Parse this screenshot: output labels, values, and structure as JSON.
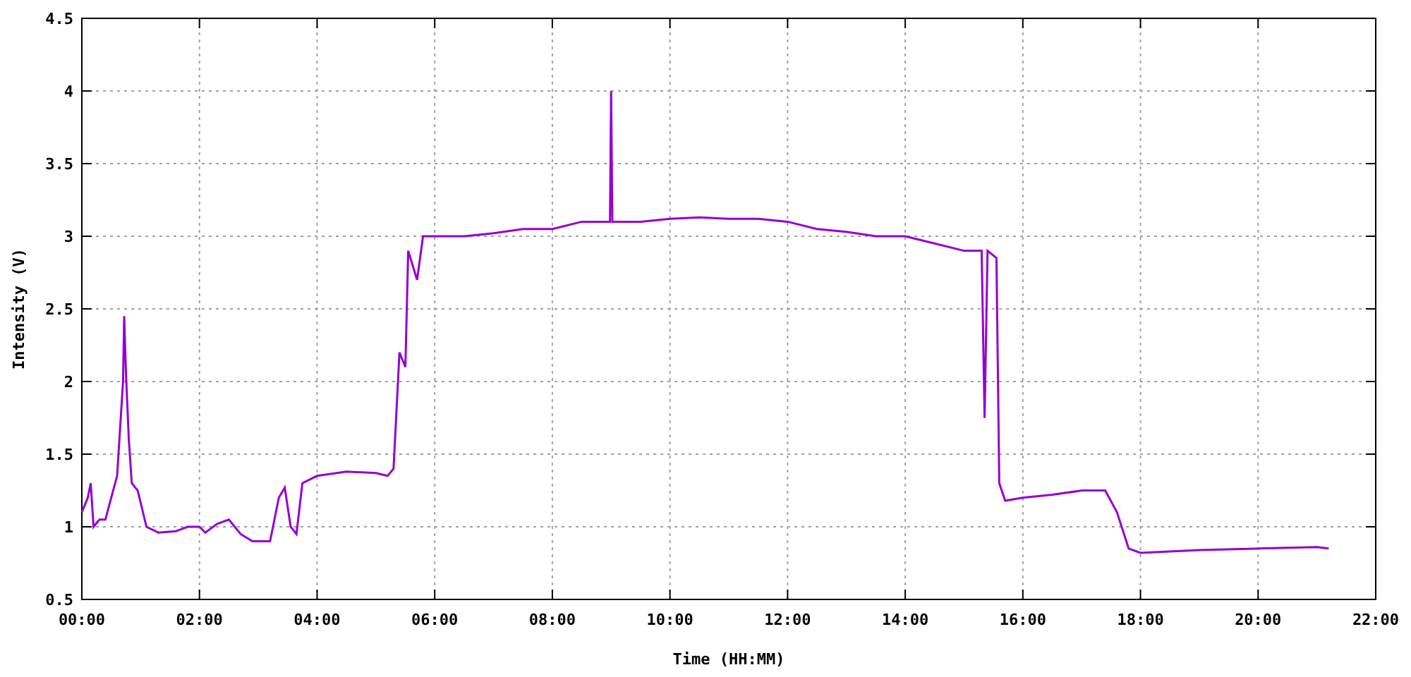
{
  "chart": {
    "chart_data": {
      "type": "line",
      "xlabel": "Time (HH:MM)",
      "ylabel": "Intensity (V)",
      "xlim": [
        0,
        22
      ],
      "ylim": [
        0.5,
        4.5
      ],
      "grid": true,
      "xticks": [
        {
          "value": 0,
          "label": "00:00"
        },
        {
          "value": 2,
          "label": "02:00"
        },
        {
          "value": 4,
          "label": "04:00"
        },
        {
          "value": 6,
          "label": "06:00"
        },
        {
          "value": 8,
          "label": "08:00"
        },
        {
          "value": 10,
          "label": "10:00"
        },
        {
          "value": 12,
          "label": "12:00"
        },
        {
          "value": 14,
          "label": "14:00"
        },
        {
          "value": 16,
          "label": "16:00"
        },
        {
          "value": 18,
          "label": "18:00"
        },
        {
          "value": 20,
          "label": "20:00"
        },
        {
          "value": 22,
          "label": "22:00"
        }
      ],
      "yticks": [
        {
          "value": 0.5,
          "label": "0.5"
        },
        {
          "value": 1,
          "label": "1"
        },
        {
          "value": 1.5,
          "label": "1.5"
        },
        {
          "value": 2,
          "label": "2"
        },
        {
          "value": 2.5,
          "label": "2.5"
        },
        {
          "value": 3,
          "label": "3"
        },
        {
          "value": 3.5,
          "label": "3.5"
        },
        {
          "value": 4,
          "label": "4"
        },
        {
          "value": 4.5,
          "label": "4.5"
        }
      ],
      "x": [
        0,
        0.1,
        0.15,
        0.2,
        0.3,
        0.4,
        0.5,
        0.6,
        0.7,
        0.72,
        0.75,
        0.8,
        0.85,
        0.95,
        1.1,
        1.3,
        1.6,
        1.8,
        2.0,
        2.1,
        2.3,
        2.5,
        2.7,
        2.9,
        3.2,
        3.35,
        3.45,
        3.55,
        3.65,
        3.75,
        4,
        4.5,
        5,
        5.2,
        5.3,
        5.4,
        5.5,
        5.55,
        5.7,
        5.8,
        6.5,
        7,
        7.5,
        8,
        8.5,
        8.98,
        9.0,
        9.02,
        9.5,
        10,
        10.5,
        11,
        11.5,
        12,
        12.5,
        13,
        13.5,
        14,
        14.5,
        15,
        15.3,
        15.35,
        15.4,
        15.55,
        15.6,
        15.7,
        16,
        16.5,
        17,
        17.4,
        17.6,
        17.8,
        18,
        18.5,
        19,
        20,
        21,
        21.2
      ],
      "series": [
        {
          "color": "#9400d3",
          "values": [
            1.1,
            1.2,
            1.3,
            1.0,
            1.05,
            1.05,
            1.2,
            1.35,
            2.0,
            2.45,
            2.05,
            1.6,
            1.3,
            1.25,
            1.0,
            0.96,
            0.97,
            1.0,
            1.0,
            0.96,
            1.02,
            1.05,
            0.95,
            0.9,
            0.9,
            1.2,
            1.27,
            1.0,
            0.95,
            1.3,
            1.35,
            1.38,
            1.37,
            1.35,
            1.4,
            2.2,
            2.1,
            2.9,
            2.7,
            3.0,
            3.0,
            3.02,
            3.05,
            3.05,
            3.1,
            3.1,
            4.0,
            3.1,
            3.1,
            3.12,
            3.13,
            3.12,
            3.12,
            3.1,
            3.05,
            3.03,
            3.0,
            3.0,
            2.95,
            2.9,
            2.9,
            1.75,
            2.9,
            2.85,
            1.3,
            1.18,
            1.2,
            1.22,
            1.25,
            1.25,
            1.1,
            0.85,
            0.82,
            0.83,
            0.84,
            0.85,
            0.86,
            0.85
          ]
        }
      ]
    }
  }
}
